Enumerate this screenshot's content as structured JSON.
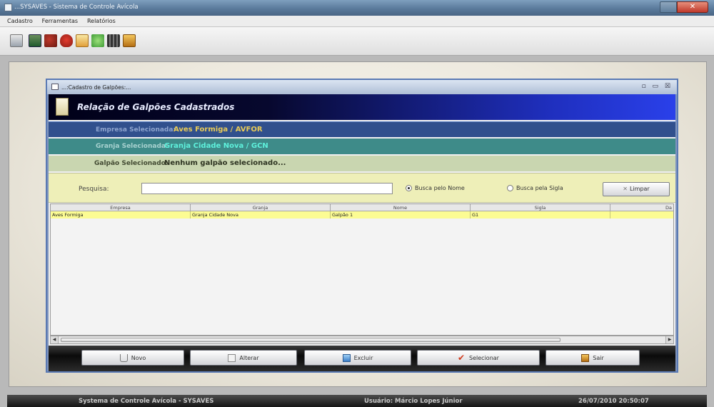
{
  "window": {
    "title": "...SYSAVES - Sistema de Controle Avícola",
    "close_glyph": "✕"
  },
  "menu": [
    "Cadastro",
    "Ferramentas",
    "Relatórios"
  ],
  "toolbar_icons": [
    "computer-icon",
    "chart-icon",
    "chicken-icon",
    "heart-icon",
    "note-icon",
    "leaf-icon",
    "grid-icon",
    "book-icon"
  ],
  "internal_frame": {
    "title": "...:Cadastro de Galpões:...",
    "controls": "▫ ▭ ☒"
  },
  "banner": {
    "title": "Relação de Galpões Cadastrados"
  },
  "empresa": {
    "label": "Empresa Selecionada:",
    "value": "Aves Formiga / AVFOR"
  },
  "granja": {
    "label": "Granja Selecionada:",
    "value": "Granja Cidade Nova / GCN"
  },
  "galpao": {
    "label": "Galpão Selecionado:",
    "value": "Nenhum galpão selecionado..."
  },
  "search": {
    "label": "Pesquisa:",
    "value": "",
    "radio_nome": "Busca pelo Nome",
    "radio_sigla": "Busca pela Sigla",
    "selected": "nome",
    "clear_label": "Limpar",
    "clear_glyph": "✕"
  },
  "table": {
    "columns": [
      "Empresa",
      "Granja",
      "Nome",
      "Sigla",
      "Da"
    ],
    "rows": [
      [
        "Aves Formiga",
        "Granja Cidade Nova",
        "Galpão 1",
        "G1",
        ""
      ]
    ]
  },
  "actions": {
    "novo": "Novo",
    "alterar": "Alterar",
    "excluir": "Excluir",
    "selecionar": "Selecionar",
    "sair": "Sair"
  },
  "status": {
    "system": "Systema de Controle Avícola - SYSAVES",
    "user": "Usuário: Márcio Lopes Júnior",
    "datetime": "26/07/2010 20:50:07"
  },
  "colors": {
    "banner": "#1f2fbe",
    "empresa_value": "#e9cb57",
    "granja_value": "#5ef1dc",
    "selected_row": "#fcfc93"
  }
}
